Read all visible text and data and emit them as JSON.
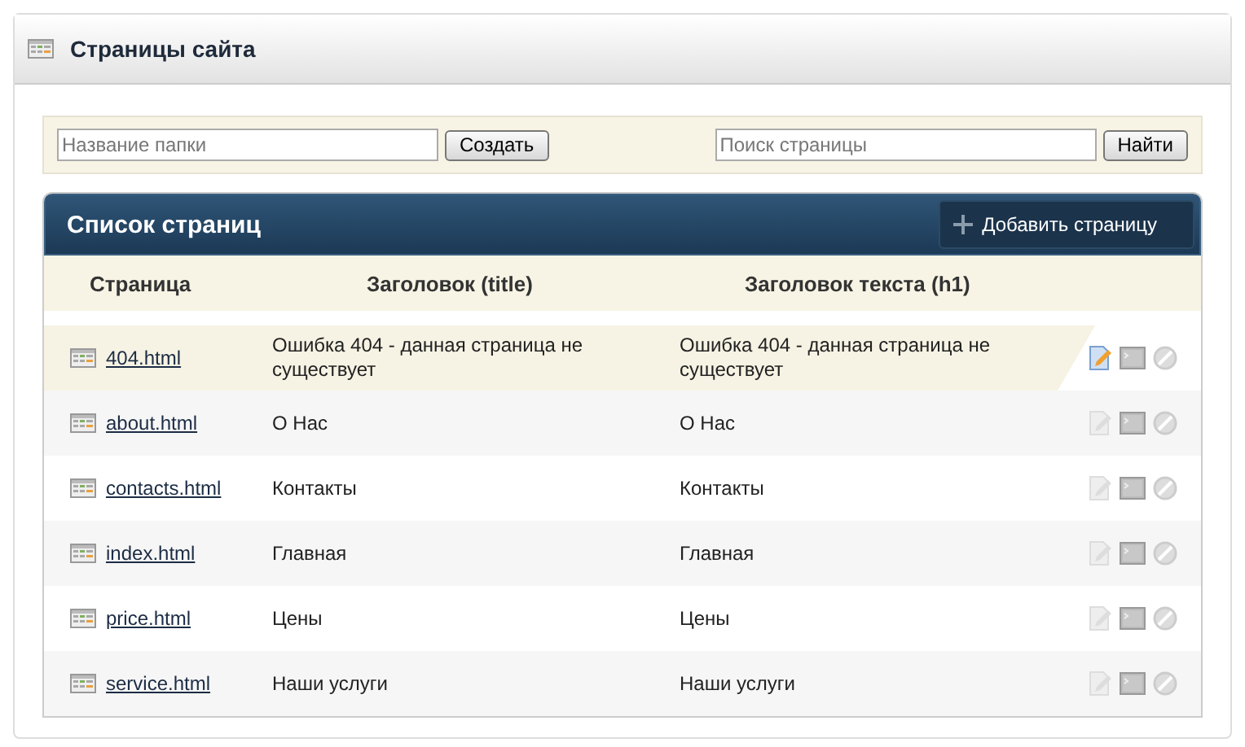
{
  "header": {
    "title": "Страницы сайта"
  },
  "toolbar": {
    "folder_field": {
      "placeholder": "Название папки"
    },
    "create_button": "Создать",
    "search_field": {
      "placeholder": "Поиск страницы"
    },
    "search_button": "Найти"
  },
  "list": {
    "title": "Список страниц",
    "add_button": "Добавить страницу",
    "columns": [
      "Страница",
      "Заголовок (title)",
      "Заголовок текста (h1)"
    ],
    "rows": [
      {
        "page": "404.html",
        "title": "Ошибка 404 - данная страница не существует",
        "h1": "Ошибка 404 - данная страница не существует",
        "selected": true
      },
      {
        "page": "about.html",
        "title": "О Нас",
        "h1": "О Нас",
        "selected": false
      },
      {
        "page": "contacts.html",
        "title": "Контакты",
        "h1": "Контакты",
        "selected": false
      },
      {
        "page": "index.html",
        "title": "Главная",
        "h1": "Главная",
        "selected": false
      },
      {
        "page": "price.html",
        "title": "Цены",
        "h1": "Цены",
        "selected": false
      },
      {
        "page": "service.html",
        "title": "Наши услуги",
        "h1": "Наши услуги",
        "selected": false
      }
    ]
  }
}
